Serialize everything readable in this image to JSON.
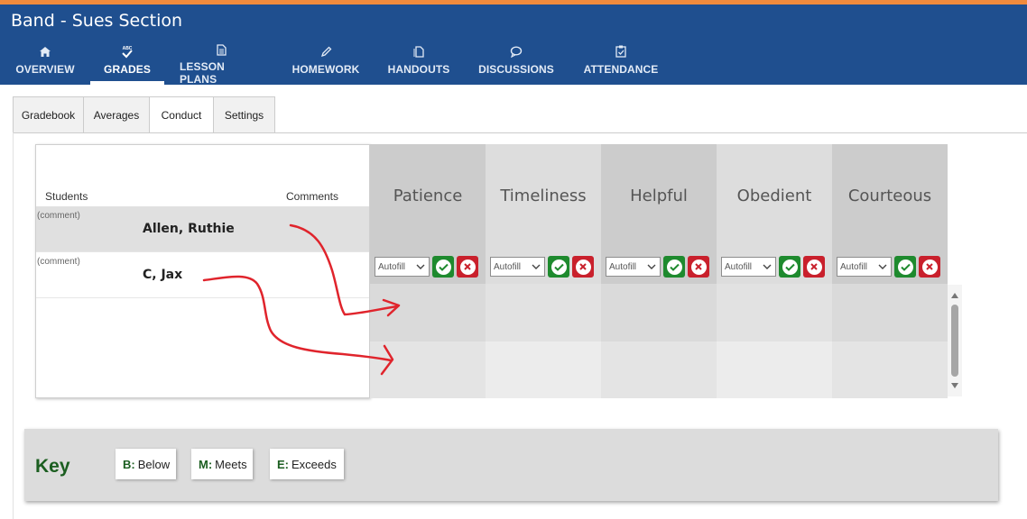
{
  "app": {
    "title": "Band - Sues Section"
  },
  "nav": {
    "items": [
      {
        "label": "OVERVIEW",
        "icon": "home-icon"
      },
      {
        "label": "GRADES",
        "icon": "grades-check-icon",
        "active": true
      },
      {
        "label": "LESSON PLANS",
        "icon": "document-icon"
      },
      {
        "label": "HOMEWORK",
        "icon": "pencil-icon"
      },
      {
        "label": "HANDOUTS",
        "icon": "copy-icon"
      },
      {
        "label": "DISCUSSIONS",
        "icon": "chat-bubble-icon"
      },
      {
        "label": "ATTENDANCE",
        "icon": "clipboard-check-icon"
      }
    ],
    "grades_icon_text": "ABC"
  },
  "subtabs": {
    "items": [
      {
        "label": "Gradebook"
      },
      {
        "label": "Averages"
      },
      {
        "label": "Conduct",
        "active": true
      },
      {
        "label": "Settings"
      }
    ]
  },
  "students": {
    "header_students": "Students",
    "header_comments": "Comments",
    "rows": [
      {
        "comment": "(comment)",
        "name": "Allen, Ruthie"
      },
      {
        "comment": "(comment)",
        "name": "C, Jax"
      }
    ]
  },
  "conduct": {
    "autofill_label": "Autofill",
    "columns": [
      {
        "label": "Patience"
      },
      {
        "label": "Timeliness"
      },
      {
        "label": "Helpful"
      },
      {
        "label": "Obedient"
      },
      {
        "label": "Courteous"
      }
    ]
  },
  "key": {
    "title": "Key",
    "items": [
      {
        "code": "B:",
        "label": "Below"
      },
      {
        "code": "M:",
        "label": "Meets"
      },
      {
        "code": "E:",
        "label": "Exceeds"
      }
    ]
  },
  "colors": {
    "header_bg": "#1f4f8f",
    "accent_stripe": "#f08a3c",
    "ok_green": "#1e8a2e",
    "cancel_red": "#c9202c",
    "key_green": "#1b5e20",
    "annotation_red": "#e0242c"
  }
}
